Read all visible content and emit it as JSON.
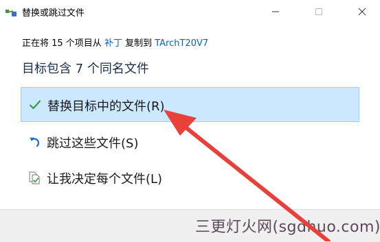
{
  "window": {
    "title": "替换或跳过文件",
    "controls": [
      "minimize-icon",
      "maximize-icon",
      "close-icon"
    ]
  },
  "copy_info": {
    "prefix": "正在将 15 个项目从 ",
    "source": "补丁",
    "middle": " 复制到 ",
    "destination": "TArchT20V7"
  },
  "heading": "目标包含 7 个同名文件",
  "options": [
    {
      "label": "替换目标中的文件(R)",
      "icon": "checkmark-icon",
      "selected": true
    },
    {
      "label": "跳过这些文件(S)",
      "icon": "skip-arrow-icon",
      "selected": false
    },
    {
      "label": "让我决定每个文件(L)",
      "icon": "decide-files-icon",
      "selected": false
    }
  ],
  "watermark": "三更灯火网(sgdhuo.com)",
  "colors": {
    "link": "#0066cc",
    "selected_bg": "#cce8ff",
    "selected_border": "#99d1ff",
    "checkmark": "#2e9e3a",
    "skip_icon": "#1e6fd0",
    "annotation_arrow": "#e8403a"
  }
}
